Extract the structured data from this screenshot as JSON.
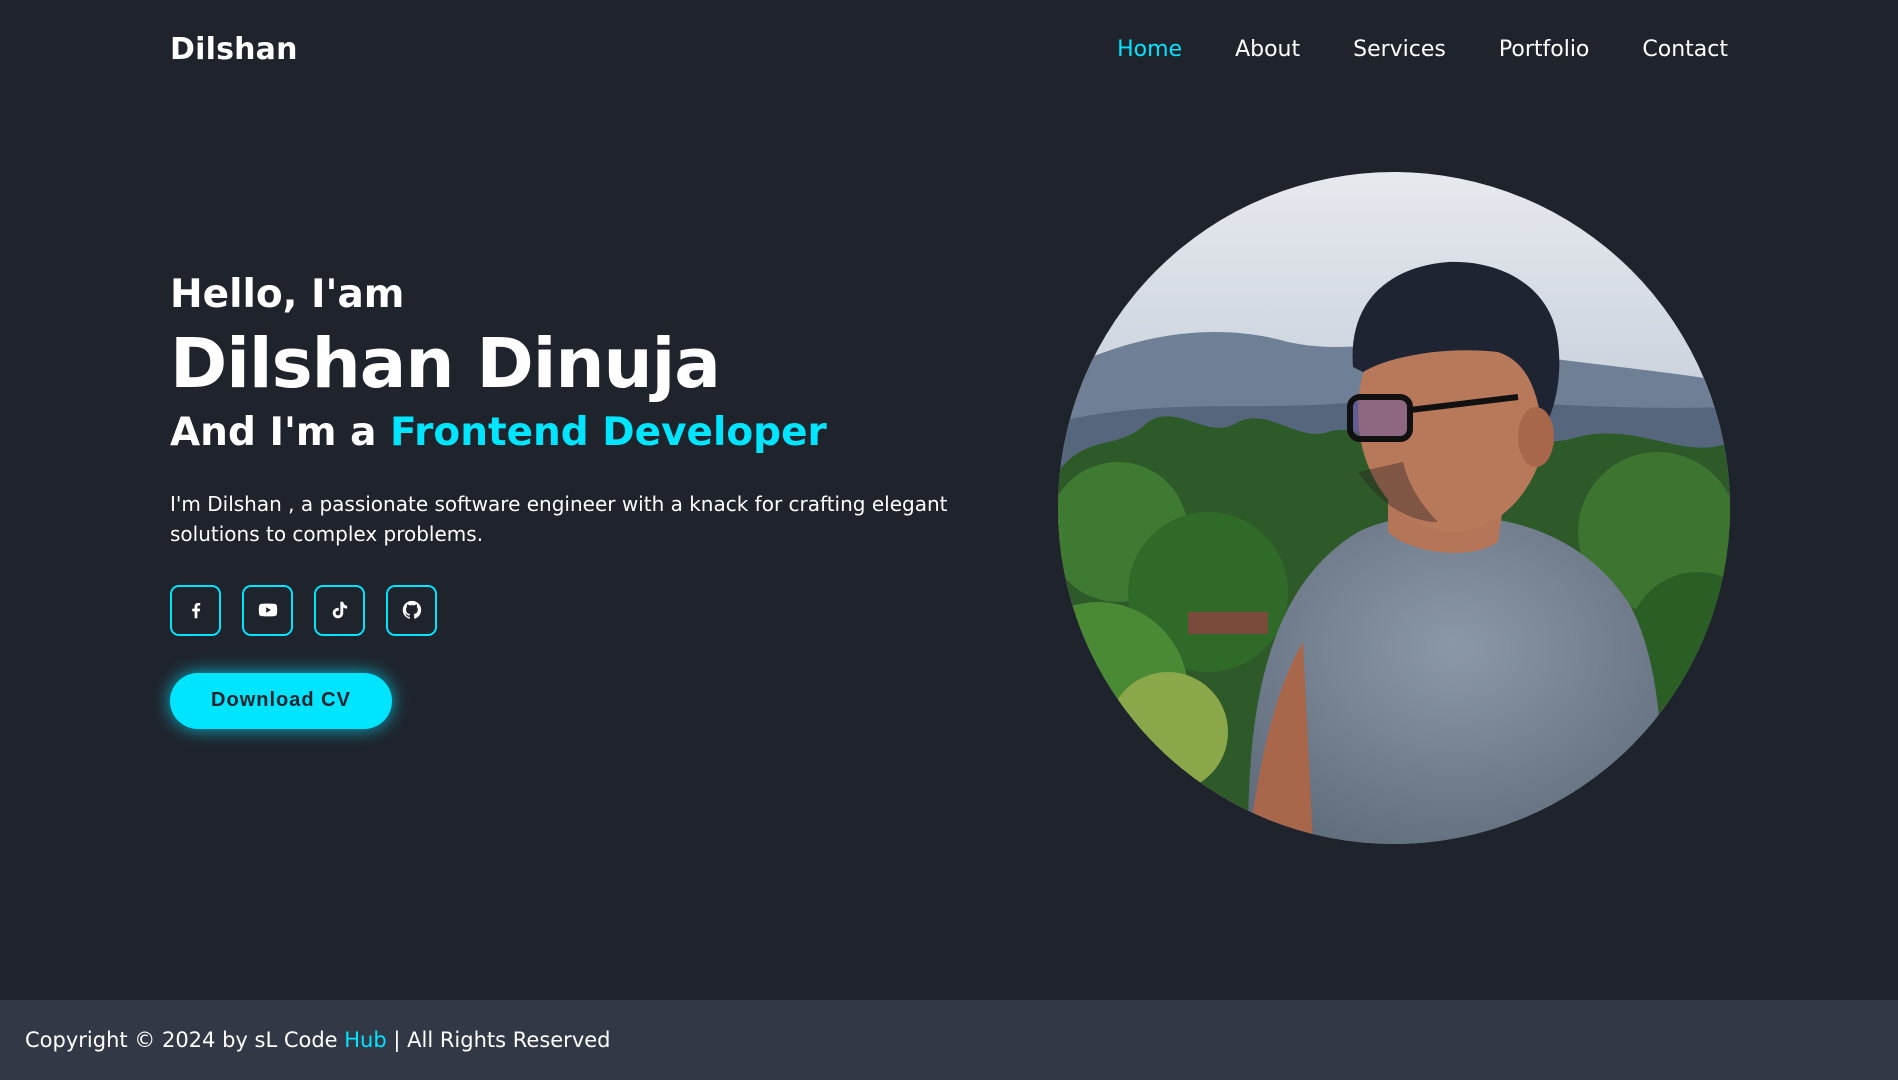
{
  "header": {
    "logo": "Dilshan",
    "nav": [
      {
        "label": "Home",
        "active": true
      },
      {
        "label": "About",
        "active": false
      },
      {
        "label": "Services",
        "active": false
      },
      {
        "label": "Portfolio",
        "active": false
      },
      {
        "label": "Contact",
        "active": false
      }
    ]
  },
  "hero": {
    "greeting": "Hello, I'am",
    "name": "Dilshan Dinuja",
    "role_prefix": "And I'm a ",
    "role_highlight": "Frontend Developer",
    "description": "I'm Dilshan , a passionate software engineer with a knack for crafting elegant solutions to complex problems.",
    "socials": [
      {
        "icon": "facebook-icon"
      },
      {
        "icon": "youtube-icon"
      },
      {
        "icon": "tiktok-icon"
      },
      {
        "icon": "github-icon"
      }
    ],
    "cv_button": "Download CV"
  },
  "footer": {
    "prefix": "Copyright © 2024 by sL Code ",
    "highlight": "Hub",
    "suffix": " | All Rights Reserved"
  },
  "colors": {
    "background": "#1f232c",
    "accent": "#00e5ff",
    "footer_bg": "#323846"
  }
}
